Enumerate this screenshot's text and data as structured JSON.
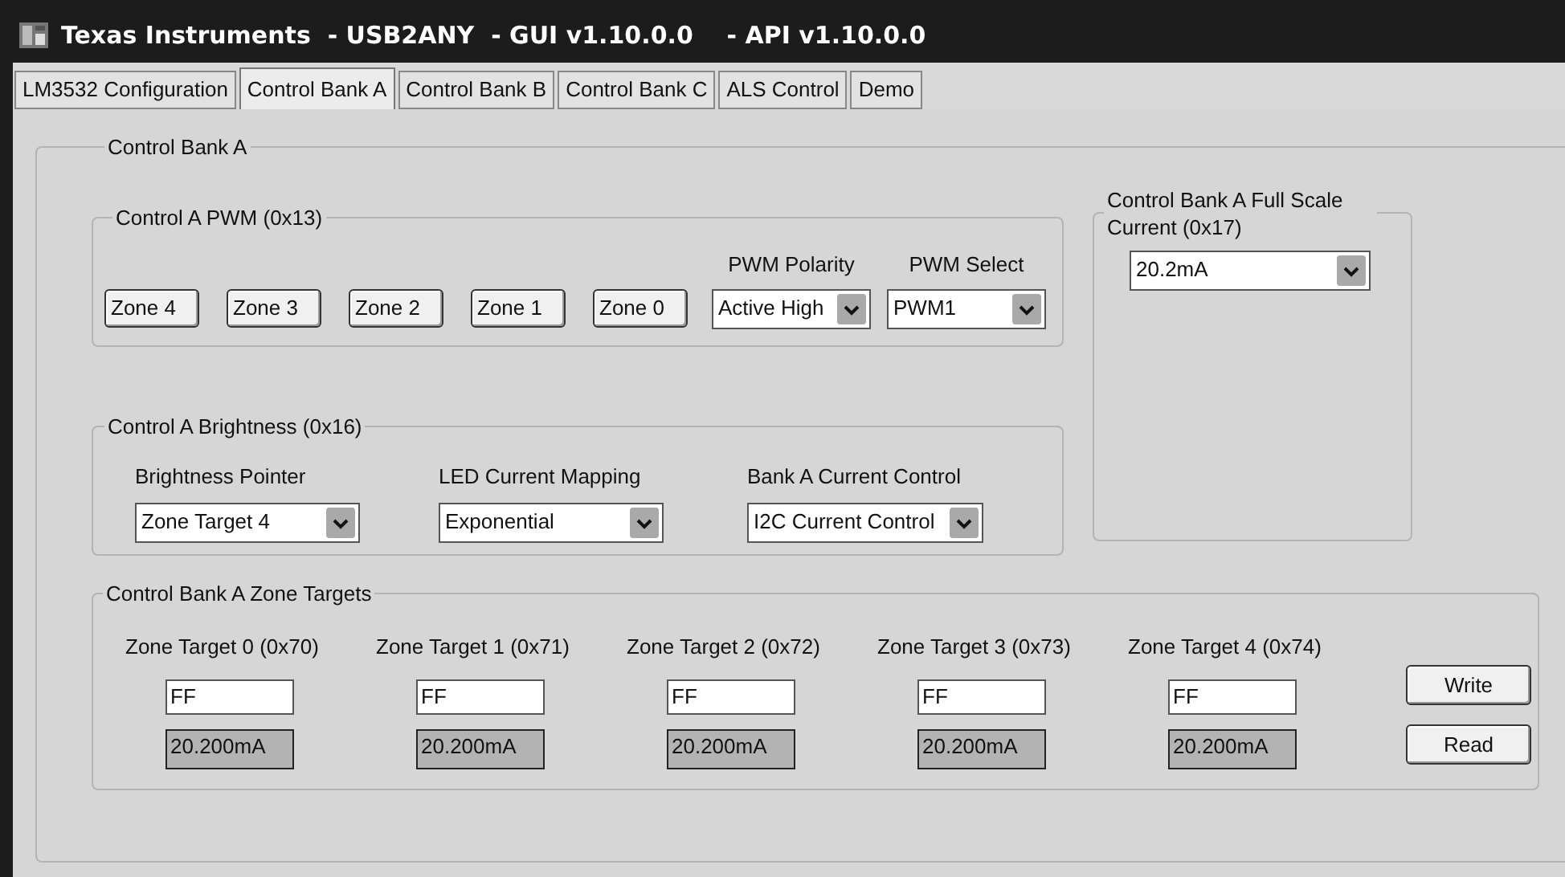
{
  "window": {
    "title": "Texas Instruments  - USB2ANY  - GUI v1.10.0.0    - API v1.10.0.0"
  },
  "tabs": [
    {
      "label": "LM3532 Configuration",
      "selected": false
    },
    {
      "label": "Control Bank A",
      "selected": true
    },
    {
      "label": "Control Bank B",
      "selected": false
    },
    {
      "label": "Control Bank C",
      "selected": false
    },
    {
      "label": "ALS Control",
      "selected": false
    },
    {
      "label": "Demo",
      "selected": false
    }
  ],
  "panel": {
    "title": "Control Bank A",
    "pwm": {
      "title": "Control A PWM (0x13)",
      "zone_buttons": [
        "Zone 4",
        "Zone 3",
        "Zone 2",
        "Zone 1",
        "Zone 0"
      ],
      "dropdowns": [
        {
          "label": "PWM Polarity",
          "value": "Active High"
        },
        {
          "label": "PWM Select",
          "value": "PWM1"
        }
      ]
    },
    "full_scale": {
      "title": "Control Bank A Full Scale Current (0x17)",
      "value": "20.2mA"
    },
    "brightness": {
      "title": "Control A Brightness (0x16)",
      "dropdowns": [
        {
          "label": "Brightness Pointer",
          "value": "Zone Target 4"
        },
        {
          "label": "LED Current Mapping",
          "value": "Exponential"
        },
        {
          "label": "Bank A Current Control",
          "value": "I2C Current Control"
        }
      ]
    },
    "zone_targets": {
      "title": "Control Bank A Zone Targets",
      "targets": [
        {
          "label": "Zone Target 0 (0x70)",
          "value": "FF",
          "reading": "20.200mA"
        },
        {
          "label": "Zone Target 1 (0x71)",
          "value": "FF",
          "reading": "20.200mA"
        },
        {
          "label": "Zone Target 2 (0x72)",
          "value": "FF",
          "reading": "20.200mA"
        },
        {
          "label": "Zone Target 3 (0x73)",
          "value": "FF",
          "reading": "20.200mA"
        },
        {
          "label": "Zone Target 4 (0x74)",
          "value": "FF",
          "reading": "20.200mA"
        }
      ],
      "buttons": [
        "Write",
        "Read"
      ]
    }
  }
}
